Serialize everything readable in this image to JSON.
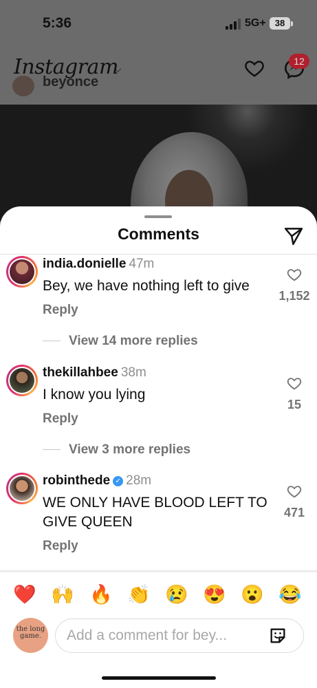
{
  "status_bar": {
    "time": "5:36",
    "network": "5G+",
    "battery": "38"
  },
  "header": {
    "logo": "Instagram",
    "messenger_badge": "12",
    "story_peek_name": "beyonce"
  },
  "sheet": {
    "title": "Comments"
  },
  "comments": [
    {
      "user": "india.donielle",
      "time": "47m",
      "text": "Bey, we have nothing left to give",
      "reply": "Reply",
      "likes": "1,152",
      "more_replies": "View 14 more replies"
    },
    {
      "user": "thekillahbee",
      "time": "38m",
      "text": "I know you lying",
      "reply": "Reply",
      "likes": "15",
      "more_replies": "View 3 more replies"
    },
    {
      "user": "robinthede",
      "verified": true,
      "time": "28m",
      "text": "WE ONLY HAVE BLOOD LEFT TO GIVE QUEEN",
      "reply": "Reply",
      "likes": "471"
    }
  ],
  "emoji_bar": [
    "❤️",
    "🙌",
    "🔥",
    "👏",
    "😢",
    "😍",
    "😮",
    "😂"
  ],
  "composer": {
    "avatar_text": "the long game.",
    "placeholder": "Add a comment for bey..."
  },
  "colors": {
    "accent_blue": "#3897f0",
    "badge_red": "#b0202d",
    "ring_gradient": [
      "#e1306c",
      "#f77737",
      "#fcaf45"
    ]
  },
  "icons": [
    "heart-icon",
    "messenger-icon",
    "share-icon",
    "verified-badge-icon",
    "sticker-icon"
  ]
}
